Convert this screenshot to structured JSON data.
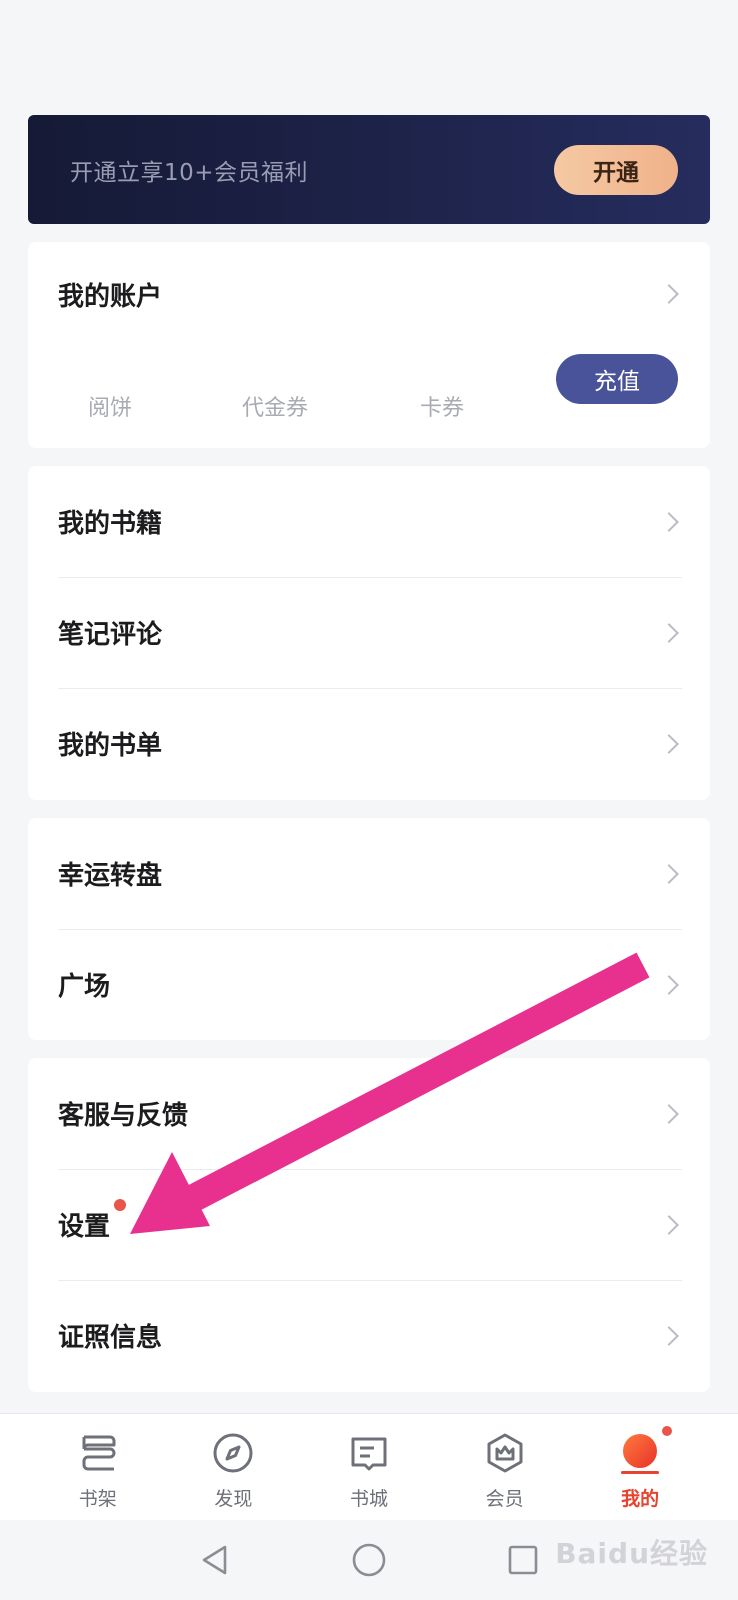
{
  "vip_banner": {
    "text": "开通立享10+会员福利",
    "button": "开通"
  },
  "account": {
    "title": "我的账户",
    "stats": [
      "阅饼",
      "代金券",
      "卡券"
    ],
    "recharge": "充值"
  },
  "group1": [
    "我的书籍",
    "笔记评论",
    "我的书单"
  ],
  "group2": [
    "幸运转盘",
    "广场"
  ],
  "group3": [
    "客服与反馈",
    "设置",
    "证照信息"
  ],
  "tabs": [
    {
      "label": "书架",
      "icon": "bookshelf-icon"
    },
    {
      "label": "发现",
      "icon": "compass-icon"
    },
    {
      "label": "书城",
      "icon": "book-icon"
    },
    {
      "label": "会员",
      "icon": "vip-crown-icon"
    },
    {
      "label": "我的",
      "icon": "profile-icon"
    }
  ],
  "watermark": "Baidu经验",
  "colors": {
    "accent": "#e8432e",
    "vip_dark": "#1d2248",
    "recharge": "#48539a",
    "arrow": "#e8318f",
    "badge": "#e8554a"
  }
}
